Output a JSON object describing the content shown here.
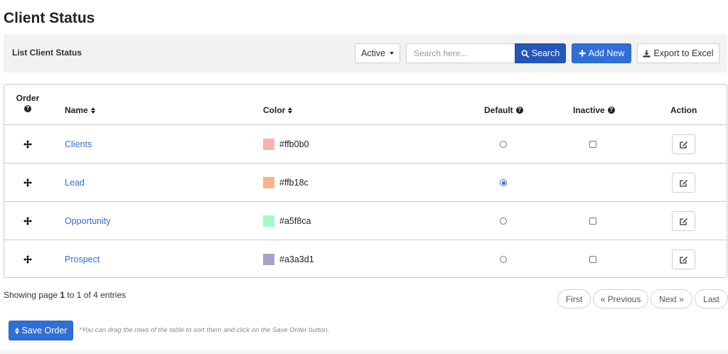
{
  "page": {
    "title": "Client Status"
  },
  "toolbar": {
    "title": "List Client Status",
    "status_filter": "Active",
    "search_placeholder": "Search here...",
    "search_label": "Search",
    "add_label": "Add New",
    "export_label": "Export to Excel"
  },
  "table": {
    "headers": {
      "order": "Order",
      "name": "Name",
      "color": "Color",
      "default": "Default",
      "inactive": "Inactive",
      "action": "Action"
    },
    "rows": [
      {
        "name": "Clients",
        "color": "#ffb0b0",
        "default": false,
        "has_inactive": true
      },
      {
        "name": "Lead",
        "color": "#ffb18c",
        "default": true,
        "has_inactive": false
      },
      {
        "name": "Opportunity",
        "color": "#a5f8ca",
        "default": false,
        "has_inactive": true
      },
      {
        "name": "Prospect",
        "color": "#a3a3d1",
        "default": false,
        "has_inactive": true
      }
    ]
  },
  "footer": {
    "showing_prefix": "Showing page ",
    "showing_page": "1",
    "showing_suffix": " to 1 of 4 entries",
    "pagination": {
      "first": "First",
      "previous": "« Previous",
      "next": "Next »",
      "last": "Last"
    },
    "save_label": "Save Order",
    "hint": "*You can drag the rows of the table to sort them and click on the Save Order button."
  },
  "colors": {
    "primary": "#2f6fd6",
    "link": "#2f6fd6",
    "toolbar_bg": "#f2f2f2"
  }
}
